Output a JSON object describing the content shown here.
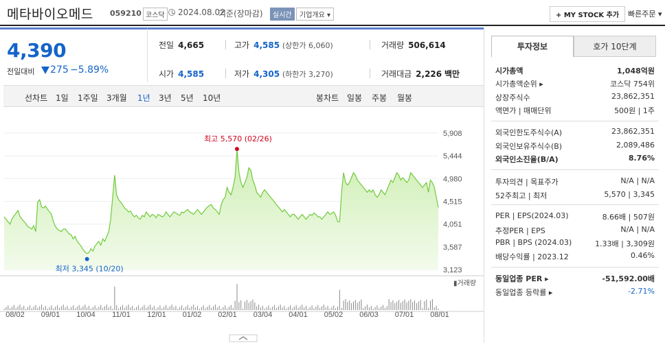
{
  "header": {
    "title": "메타바이오메드",
    "code": "059210",
    "market": "코스닥",
    "date": "2024.08.02",
    "date_status": "기준(장마감)",
    "realtime": "실시간",
    "overview": "기업개요 ▾",
    "mystock": "+ MY STOCK 추가",
    "quickorder": "빠른주문 ▾"
  },
  "price": {
    "current": "4,390",
    "prev_label": "전일대비",
    "change": "275",
    "change_pct": "−5.89%",
    "color": "#1464c8"
  },
  "stats": {
    "prev_close_label": "전일",
    "prev_close": "4,665",
    "high_label": "고가",
    "high": "4,585",
    "upper_limit": "(상한가 6,060)",
    "volume_label": "거래량",
    "volume": "506,614",
    "open_label": "시가",
    "open": "4,585",
    "low_label": "저가",
    "low": "4,305",
    "lower_limit": "(하한가 3,270)",
    "turnover_label": "거래대금",
    "turnover": "2,226",
    "turnover_unit": "백만"
  },
  "tabs": {
    "line_chart": "선차트",
    "periods": [
      "1일",
      "1주일",
      "3개월",
      "1년",
      "3년",
      "5년",
      "10년"
    ],
    "selected": "1년",
    "candle_chart": "봉차트",
    "candle_periods": [
      "일봉",
      "주봉",
      "월봉"
    ]
  },
  "chart_data": {
    "type": "area",
    "title": "",
    "y_ticks": [
      5908,
      5444,
      4980,
      4515,
      4051,
      3587,
      3123
    ],
    "ylim": [
      3123,
      5908
    ],
    "x_ticks": [
      "08/02",
      "09/01",
      "10/04",
      "11/01",
      "12/01",
      "01/02",
      "02/01",
      "03/04",
      "04/01",
      "05/02",
      "06/03",
      "07/01",
      "08/01"
    ],
    "high_annotation": "최고 5,570 (02/26)",
    "low_annotation": "최저 3,345 (10/20)",
    "volume_label": "거래량",
    "series": [
      {
        "values": [
          4200,
          4150,
          4100,
          4050,
          4160,
          4220,
          4270,
          4330,
          4210,
          4150,
          4110,
          4060,
          4000,
          3980,
          3950,
          4020,
          3900,
          4500,
          4550,
          4400,
          4380,
          4420,
          4350,
          4300,
          4250,
          4100,
          4000,
          3950,
          3920,
          3900,
          3950,
          3950,
          3900,
          3850,
          3830,
          3750,
          3800,
          3700,
          3650,
          3600,
          3530,
          3480,
          3450,
          3470,
          3550,
          3500,
          3600,
          3650,
          3700,
          3620,
          3750,
          3700,
          3800,
          3900,
          4150,
          4600,
          5050,
          4650,
          4550,
          4500,
          4450,
          4380,
          4350,
          4300,
          4320,
          4250,
          4200,
          4230,
          4180,
          4150,
          4230,
          4200,
          4300,
          4250,
          4200,
          4250,
          4230,
          4180,
          4250,
          4230,
          4200,
          4220,
          4300,
          4250,
          4200,
          4250,
          4300,
          4280,
          4250,
          4230,
          4300,
          4280,
          4320,
          4350,
          4300,
          4280,
          4250,
          4300,
          4350,
          4300,
          4250,
          4300,
          4350,
          4400,
          4430,
          4450,
          4380,
          4350,
          4300,
          4250,
          4450,
          4550,
          4600,
          4800,
          4700,
          4650,
          4800,
          5000,
          5570,
          5100,
          4900,
          4800,
          4900,
          5000,
          5200,
          5150,
          4950,
          4850,
          4700,
          4650,
          4600,
          4700,
          4750,
          4700,
          4650,
          4600,
          4550,
          4500,
          4450,
          4400,
          4350,
          4300,
          4350,
          4300,
          4250,
          4200,
          4250,
          4250,
          4200,
          4150,
          4200,
          4250,
          4200,
          4150,
          4200,
          4250,
          4230,
          4280,
          4250,
          4200,
          4200,
          4150,
          4200,
          4250,
          4300,
          4250,
          4270,
          4300,
          4230,
          4100,
          4100,
          4700,
          5100,
          4900,
          4850,
          4900,
          5000,
          5100,
          5050,
          4950,
          4900,
          4850,
          4800,
          4750,
          4700,
          4750,
          4700,
          4750,
          4650,
          4600,
          4650,
          4750,
          4700,
          4650,
          4750,
          4850,
          4950,
          4900,
          5000,
          5100,
          5050,
          4950,
          5000,
          4950,
          4900,
          4950,
          5100,
          5050,
          5000,
          4950,
          4900,
          4850,
          4800,
          4850,
          4900,
          4700,
          4950,
          4900,
          4800,
          4600,
          4390
        ],
        "color": "#6fca3a"
      }
    ]
  },
  "right": {
    "tab_active": "투자정보",
    "tab_inactive": "호가 10단계",
    "rows": [
      {
        "k": "시가총액",
        "v": "1,048억원",
        "bold": true
      },
      {
        "k": "시가총액순위 ▸",
        "v": "코스닥 754위"
      },
      {
        "k": "상장주식수",
        "v": "23,862,351"
      },
      {
        "k": "액면가 | 매매단위",
        "v": "500원 | 1주"
      },
      {
        "k": "외국인한도주식수(A)",
        "v": "23,862,351"
      },
      {
        "k": "외국인보유주식수(B)",
        "v": "2,089,486"
      },
      {
        "k": "외국인소진율(B/A)",
        "v": "8.76%",
        "bold": true
      },
      {
        "k": "투자의견 | 목표주가",
        "v": "N/A | N/A"
      },
      {
        "k": "52주최고 | 최저",
        "v": "5,570 | 3,345"
      },
      {
        "k": "PER | EPS(2024.03)",
        "v": "8.66배 | 507원"
      },
      {
        "k": "추정PER | EPS",
        "v": "N/A | N/A"
      },
      {
        "k": "PBR | BPS (2024.03)",
        "v": "1.33배 | 3,309원"
      },
      {
        "k": "배당수익률 | 2023.12",
        "v": "0.46%"
      },
      {
        "k": "동일업종 PER ▸",
        "v": "-51,592.00배",
        "bold": true
      },
      {
        "k": "동일업종 등락률 ▸",
        "v": "-2.71%",
        "blue": true
      }
    ]
  }
}
